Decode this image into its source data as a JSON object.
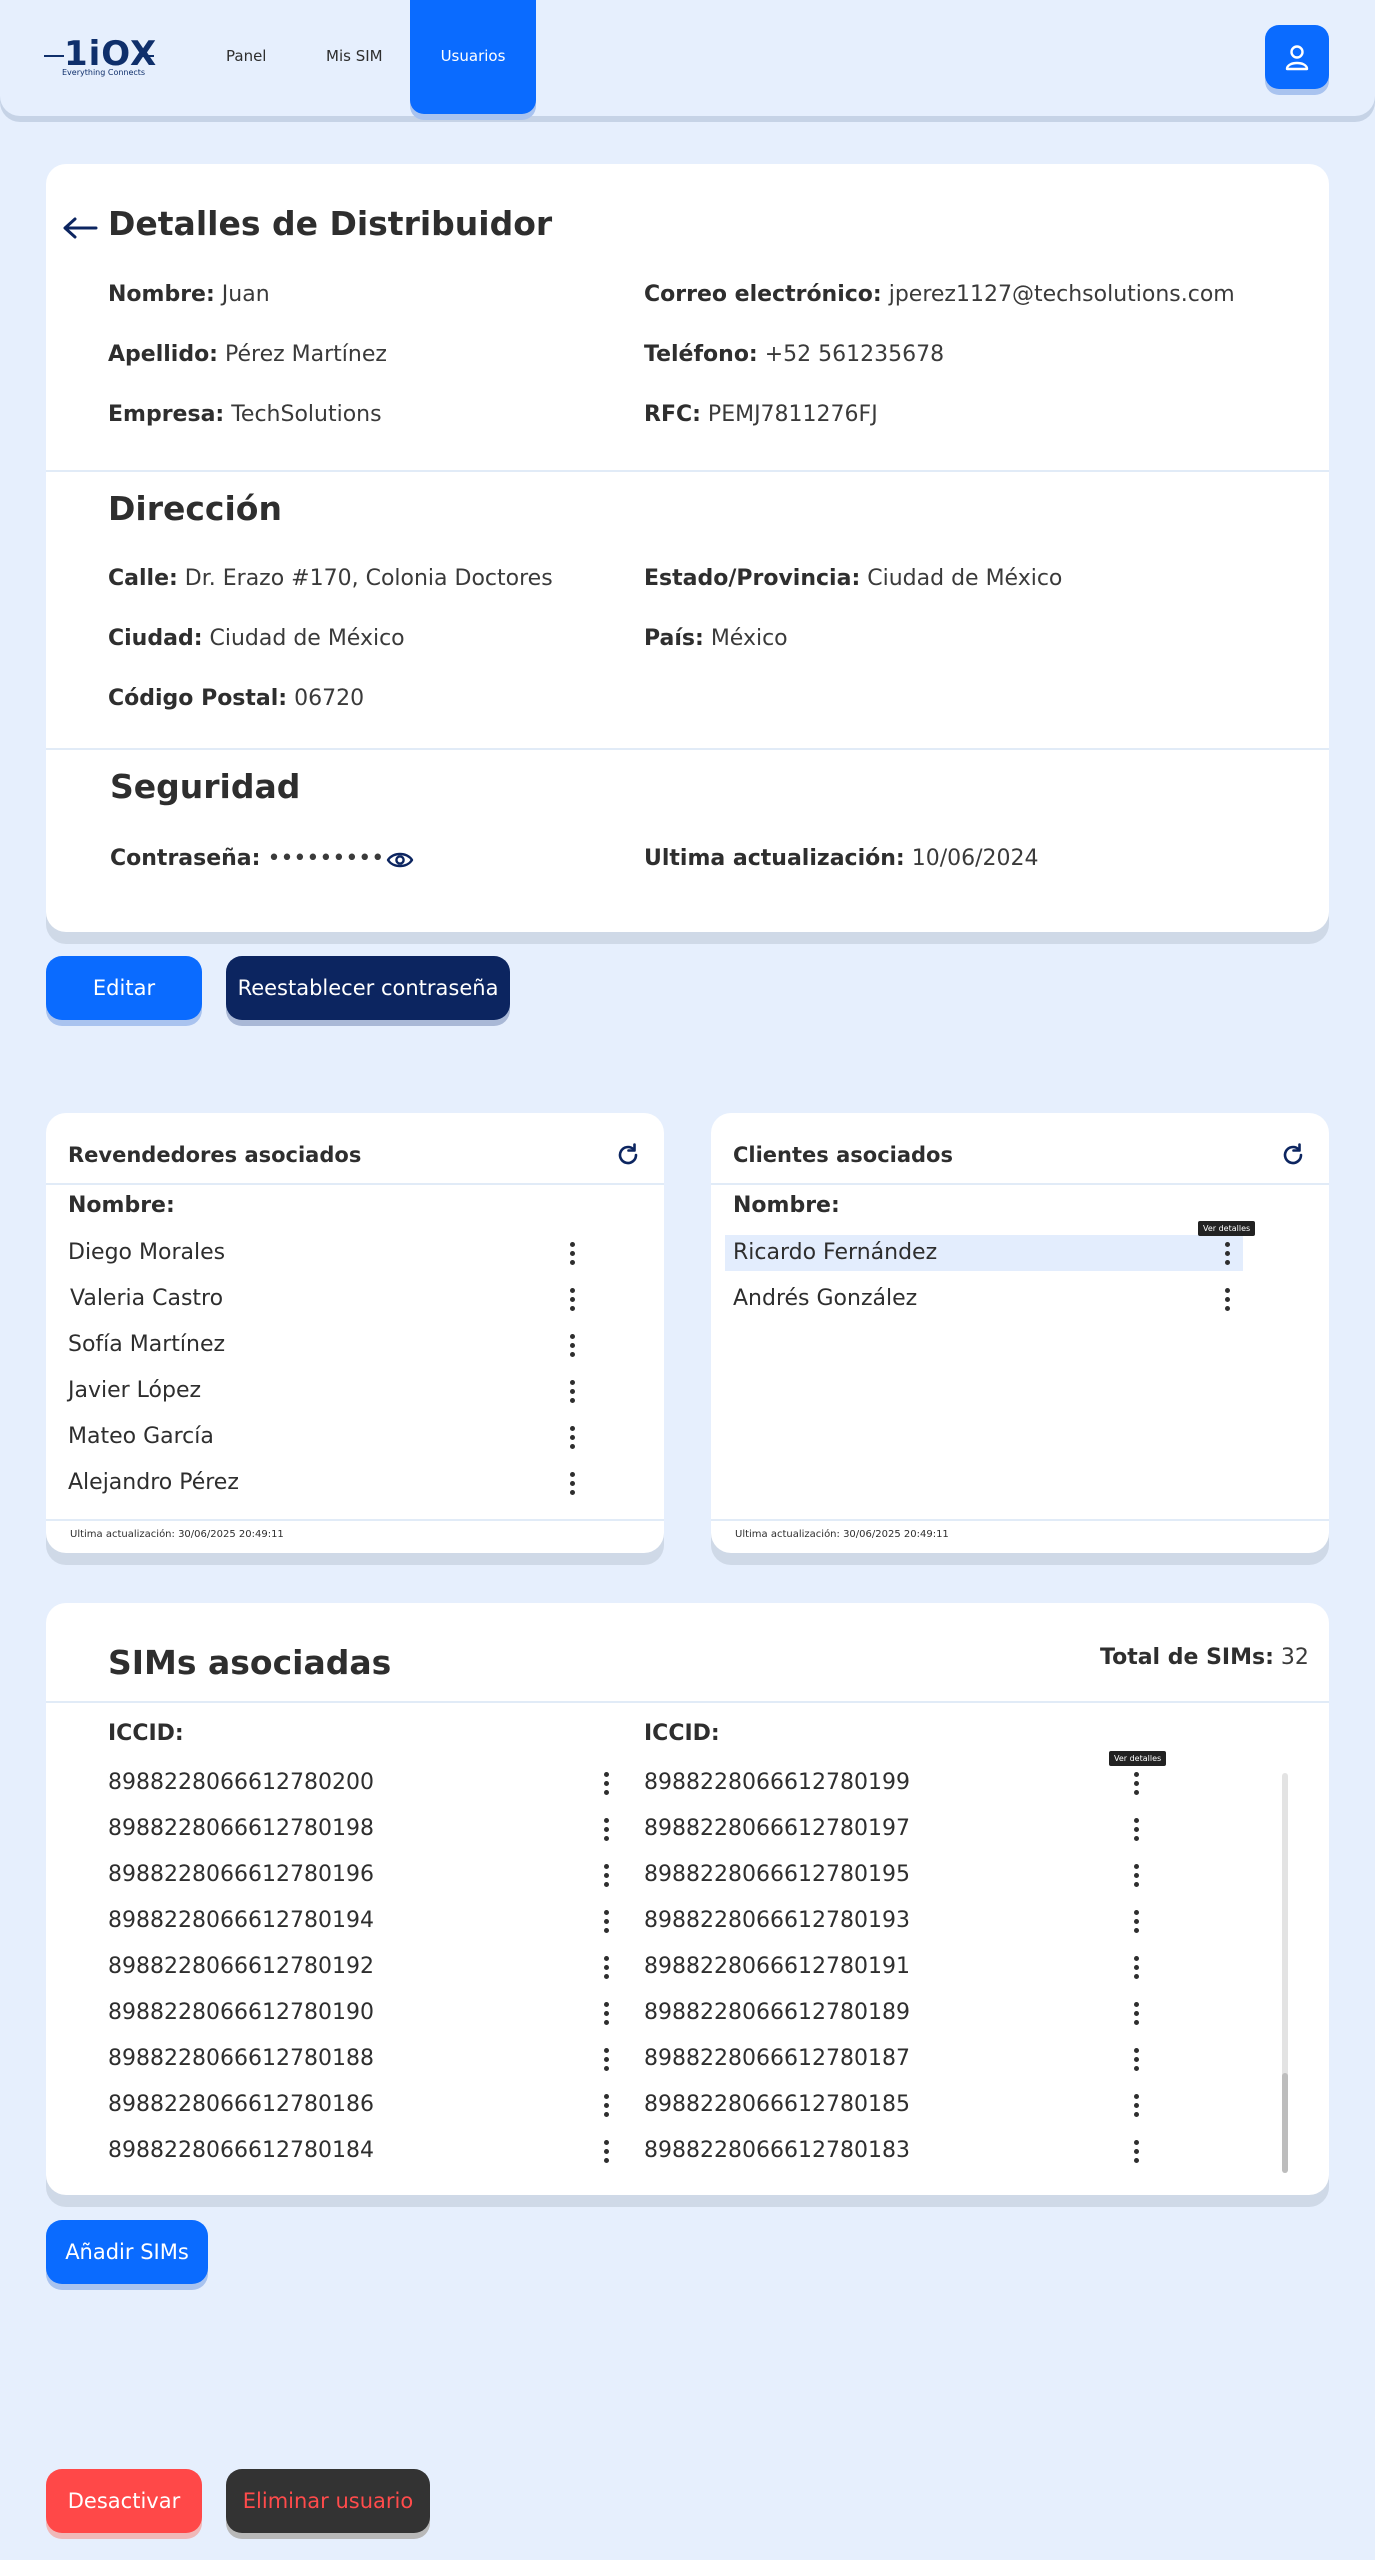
{
  "nav": {
    "logo_text": "1iOX",
    "logo_tagline": "Everything Connects",
    "items": [
      "Panel",
      "Mis SIM",
      "Usuarios"
    ]
  },
  "details": {
    "title": "Detalles de Distribuidor",
    "nombre_label": "Nombre:",
    "nombre": "Juan",
    "apellido_label": "Apellido:",
    "apellido": "Pérez Martínez",
    "empresa_label": "Empresa:",
    "empresa": "TechSolutions",
    "correo_label": "Correo electrónico:",
    "correo": "jperez1127@techsolutions.com",
    "telefono_label": "Teléfono:",
    "telefono": "+52 561235678",
    "rfc_label": "RFC:",
    "rfc": "PEMJ7811276FJ"
  },
  "direccion": {
    "title": "Dirección",
    "calle_label": "Calle:",
    "calle": "Dr. Erazo #170, Colonia Doctores",
    "ciudad_label": "Ciudad:",
    "ciudad": "Ciudad de México",
    "cp_label": "Código Postal:",
    "cp": "06720",
    "estado_label": "Estado/Provincia:",
    "estado": "Ciudad de México",
    "pais_label": "País:",
    "pais": "México"
  },
  "seguridad": {
    "title": "Seguridad",
    "password_label": "Contraseña:",
    "password": "•••••••••",
    "update_label": "Ultima actualización:",
    "update": "10/06/2024"
  },
  "actions": {
    "editar": "Editar",
    "reset": "Reestablecer contraseña",
    "anadir_sims": "Añadir SIMs",
    "desactivar": "Desactivar",
    "eliminar": "Eliminar usuario"
  },
  "revendedores": {
    "title": "Revendedores asociados",
    "col": "Nombre:",
    "items": [
      "Diego Morales",
      "Valeria Castro",
      "Sofía Martínez",
      "Javier López",
      "Mateo García",
      "Alejandro Pérez"
    ],
    "footer": "Ultima actualización: 30/06/2025 20:49:11"
  },
  "clientes": {
    "title": "Clientes asociados",
    "col": "Nombre:",
    "items": [
      "Ricardo Fernández",
      "Andrés González"
    ],
    "tooltip": "Ver detalles",
    "footer": "Ultima actualización: 30/06/2025 20:49:11"
  },
  "sims": {
    "title": "SIMs asociadas",
    "total_label": "Total de SIMs:",
    "total": "32",
    "col": "ICCID:",
    "tooltip": "Ver detalles",
    "left": [
      "8988228066612780200",
      "8988228066612780198",
      "8988228066612780196",
      "8988228066612780194",
      "8988228066612780192",
      "8988228066612780190",
      "8988228066612780188",
      "8988228066612780186",
      "8988228066612780184"
    ],
    "right": [
      "8988228066612780199",
      "8988228066612780197",
      "8988228066612780195",
      "8988228066612780193",
      "8988228066612780191",
      "8988228066612780189",
      "8988228066612780187",
      "8988228066612780185",
      "8988228066612780183"
    ]
  },
  "colors": {
    "accent": "#0a6bff",
    "navy": "#0c2560",
    "danger": "#ff4848",
    "background": "#e6effd"
  }
}
